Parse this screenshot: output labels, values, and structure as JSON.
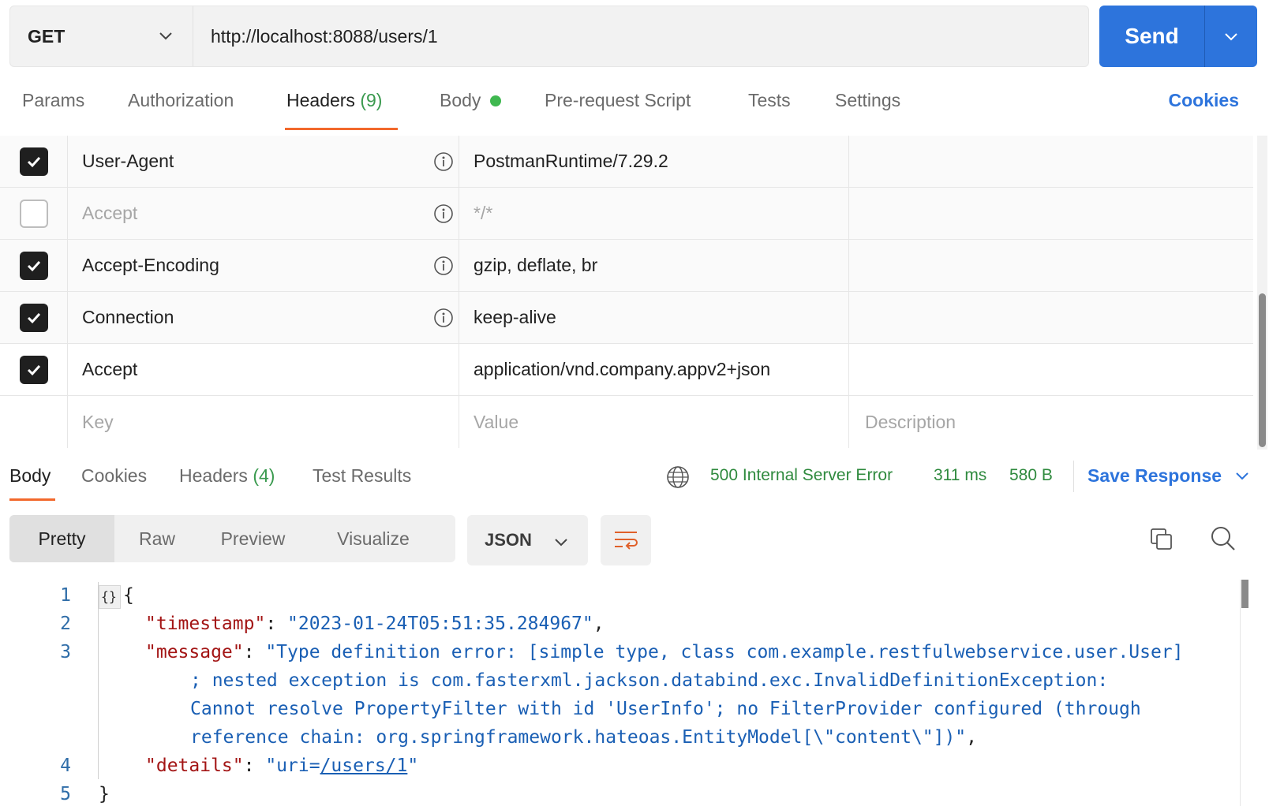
{
  "request": {
    "method": "GET",
    "url": "http://localhost:8088/users/1",
    "send_label": "Send"
  },
  "req_tabs": {
    "params": "Params",
    "authorization": "Authorization",
    "headers": "Headers",
    "headers_count": "(9)",
    "body": "Body",
    "pre_request": "Pre-request Script",
    "tests": "Tests",
    "settings": "Settings",
    "cookies": "Cookies"
  },
  "headers": {
    "rows": [
      {
        "key": "User-Agent",
        "value": "PostmanRuntime/7.29.2",
        "checked": true
      },
      {
        "key": "Accept",
        "value": "*/*",
        "checked": false
      },
      {
        "key": "Accept-Encoding",
        "value": "gzip, deflate, br",
        "checked": true
      },
      {
        "key": "Connection",
        "value": "keep-alive",
        "checked": true
      },
      {
        "key": "Accept",
        "value": "application/vnd.company.appv2+json",
        "checked": true
      }
    ],
    "placeholder": {
      "key": "Key",
      "value": "Value",
      "description": "Description"
    }
  },
  "response": {
    "tabs": {
      "body": "Body",
      "cookies": "Cookies",
      "headers": "Headers",
      "headers_count": "(4)",
      "tests": "Test Results"
    },
    "status": "500 Internal Server Error",
    "time": "311 ms",
    "size": "580 B",
    "save_label": "Save Response",
    "views": {
      "pretty": "Pretty",
      "raw": "Raw",
      "preview": "Preview",
      "visualize": "Visualize"
    },
    "format": "JSON",
    "lines": {
      "l1": "1",
      "l2": "2",
      "l3": "3",
      "l4": "4",
      "l5": "5",
      "open": "{",
      "ts_key": "\"timestamp\"",
      "ts_val": "\"2023-01-24T05:51:35.284967\"",
      "msg_key": "\"message\"",
      "msg_val_1": "\"Type definition error: [simple type, class com.example.restfulwebservice.user.User]",
      "msg_val_2": "; nested exception is com.fasterxml.jackson.databind.exc.InvalidDefinitionException:",
      "msg_val_3": "Cannot resolve PropertyFilter with id 'UserInfo'; no FilterProvider configured (through",
      "msg_val_4": "reference chain: org.springframework.hateoas.EntityModel[\\\"content\\\"])\"",
      "det_key": "\"details\"",
      "det_val_q1": "\"uri=",
      "det_val_link": "/users/1",
      "det_val_q2": "\"",
      "close": "}"
    }
  },
  "colors": {
    "accent": "#2d74dc",
    "tab_underline": "#f2682c",
    "status_ok": "#2f8a3e",
    "json_key": "#a31515",
    "json_string": "#1a5fb4"
  }
}
